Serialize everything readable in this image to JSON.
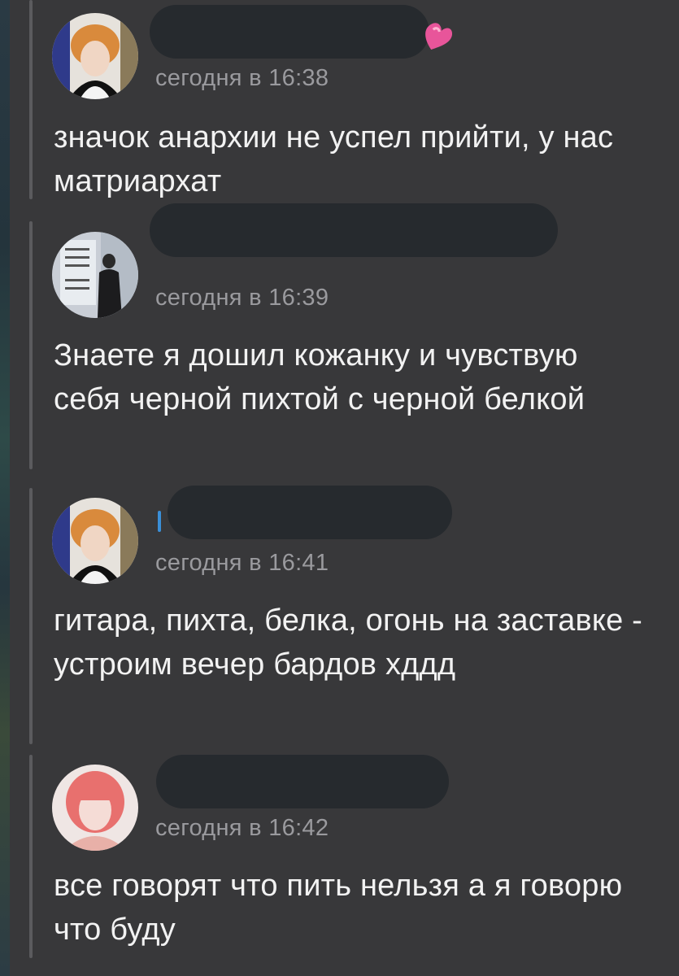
{
  "messages": [
    {
      "timestamp": "сегодня в 16:38",
      "text": "значок анархии не успел прийти, у нас матриархат",
      "avatar": "avatar-orange-hair-boy"
    },
    {
      "timestamp": "сегодня в 16:39",
      "text": "Знаете я дошил кожанку и чувствую себя черной пихтой с черной белкой",
      "avatar": "avatar-mirror-selfie"
    },
    {
      "timestamp": "сегодня в 16:41",
      "text": "гитара, пихта, белка, огонь на заставке - устроим вечер бардов хддд",
      "avatar": "avatar-orange-hair-boy"
    },
    {
      "timestamp": "сегодня в 16:42",
      "text": "все говорят что пить нельзя а я говорю что буду",
      "avatar": "avatar-pink-hair-girl"
    }
  ],
  "icons": {
    "heart": "heart-icon"
  },
  "colors": {
    "background": "#38383a",
    "text": "#f2f2f2",
    "timestamp": "#9a9a9e",
    "name_redaction": "#262a2e",
    "heart": "#e8559a"
  }
}
